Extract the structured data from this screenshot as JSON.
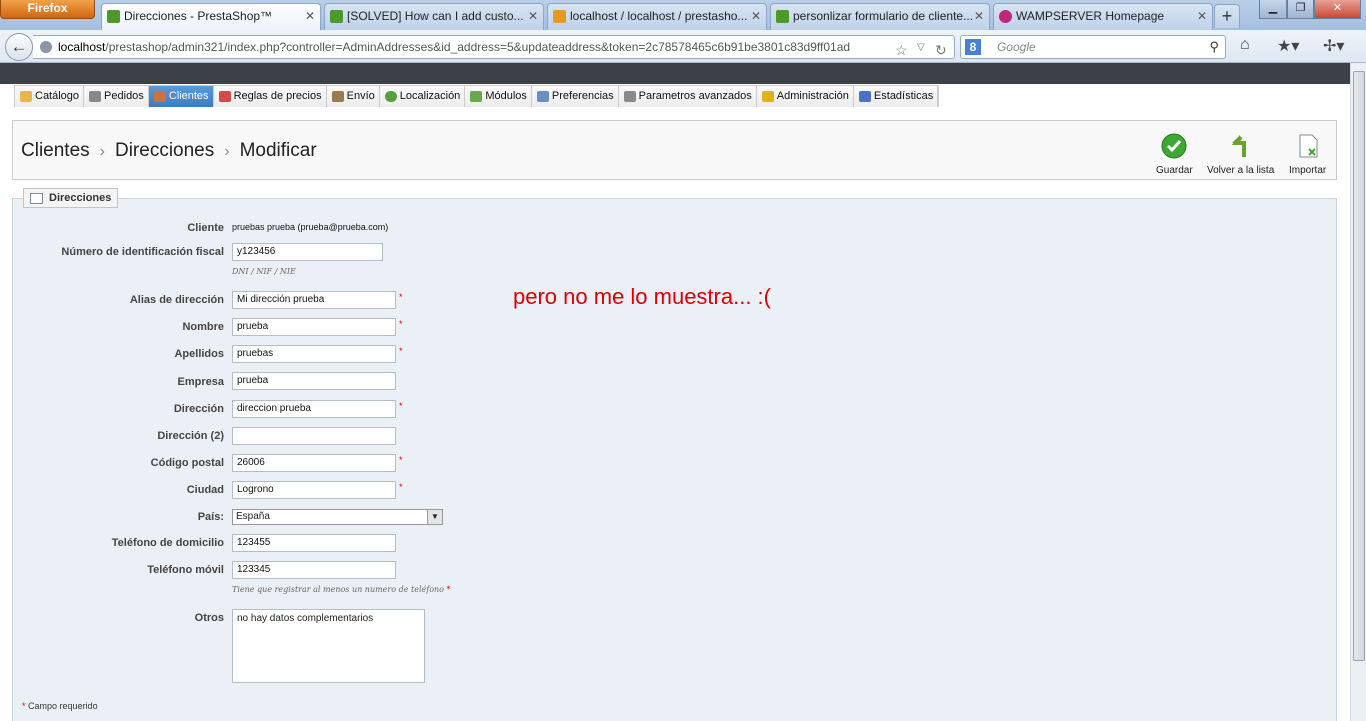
{
  "browser": {
    "menu_button": "Firefox",
    "tabs": [
      {
        "title": "Direcciones - PrestaShop™",
        "close": "✕",
        "favicon_color": "#4d9a2a",
        "active": true
      },
      {
        "title": "[SOLVED] How can I add custo...",
        "close": "✕",
        "favicon_color": "#4d9a2a"
      },
      {
        "title": "localhost / localhost / prestasho...",
        "close": "✕",
        "favicon_color": "#e79a1e"
      },
      {
        "title": "personlizar formulario de cliente...",
        "close": "✕",
        "favicon_color": "#4d9a2a"
      },
      {
        "title": "WAMPSERVER Homepage",
        "close": "✕",
        "favicon_color": "#c0267a"
      }
    ],
    "new_tab": "+",
    "window_controls": {
      "minimize": "▁",
      "maximize": "❐",
      "close": "✕"
    },
    "url_host": "localhost",
    "url_path": "/prestashop/admin321/index.php?controller=AdminAddresses&id_address=5&updateaddress&token=2c78578465c6b91be3801c83d9ff01ad",
    "search_placeholder": "Google",
    "search_engine_letter": "8",
    "icons": [
      "back-arrow-icon",
      "globe-icon",
      "bookmark-star-icon",
      "dropdown-icon",
      "reload-icon",
      "search-icon",
      "home-icon",
      "bookmarks-icon",
      "addon-icon"
    ]
  },
  "admin_menu": [
    {
      "label": "Catálogo",
      "icon": "folder-icon",
      "color": "#e8b64a"
    },
    {
      "label": "Pedidos",
      "icon": "cart-icon",
      "color": "#888888"
    },
    {
      "label": "Clientes",
      "icon": "user-icon",
      "color": "#c9733f",
      "active": true
    },
    {
      "label": "Reglas de precios",
      "icon": "price-rules-icon",
      "color": "#d64a4a"
    },
    {
      "label": "Envío",
      "icon": "truck-icon",
      "color": "#9a7b4f"
    },
    {
      "label": "Localización",
      "icon": "globe-icon",
      "color": "#5a9c3e"
    },
    {
      "label": "Módulos",
      "icon": "puzzle-icon",
      "color": "#6aa84f"
    },
    {
      "label": "Preferencias",
      "icon": "preferences-icon",
      "color": "#6b8fc2"
    },
    {
      "label": "Parametros avanzados",
      "icon": "wrench-icon",
      "color": "#8a8a8a"
    },
    {
      "label": "Administración",
      "icon": "key-icon",
      "color": "#e0b21c"
    },
    {
      "label": "Estadísticas",
      "icon": "chart-icon",
      "color": "#4a72c2"
    }
  ],
  "breadcrumb": {
    "items": [
      "Clientes",
      "Direcciones",
      "Modificar"
    ],
    "separator": "›"
  },
  "toolbar": {
    "save": "Guardar",
    "back": "Volver a la lista",
    "import": "Importar"
  },
  "form": {
    "legend": "Direcciones",
    "cliente_label": "Cliente",
    "cliente_value": "pruebas prueba (prueba@prueba.com)",
    "nif_label": "Número de identificación fiscal",
    "nif_value": "y123456",
    "nif_hint": "DNI / NIF / NIE",
    "alias_label": "Alias de dirección",
    "alias_value": "Mi dirección prueba",
    "nombre_label": "Nombre",
    "nombre_value": "prueba",
    "apellidos_label": "Apellidos",
    "apellidos_value": "pruebas",
    "empresa_label": "Empresa",
    "empresa_value": "prueba",
    "direccion_label": "Dirección",
    "direccion_value": "direccion prueba",
    "direccion2_label": "Dirección (2)",
    "direccion2_value": "",
    "cp_label": "Código postal",
    "cp_value": "26006",
    "ciudad_label": "Ciudad",
    "ciudad_value": "Logrono",
    "pais_label": "País:",
    "pais_value": "España",
    "tel_label": "Teléfono de domicilio",
    "tel_value": "123455",
    "movil_label": "Teléfono móvil",
    "movil_value": "123345",
    "phone_hint": "Tiene que registrar al menos un numero de teléfono",
    "otros_label": "Otros",
    "otros_value": "no hay datos complementarios",
    "required_star": "*",
    "required_note": "Campo requerido"
  },
  "annotation": "pero no me lo muestra... :("
}
